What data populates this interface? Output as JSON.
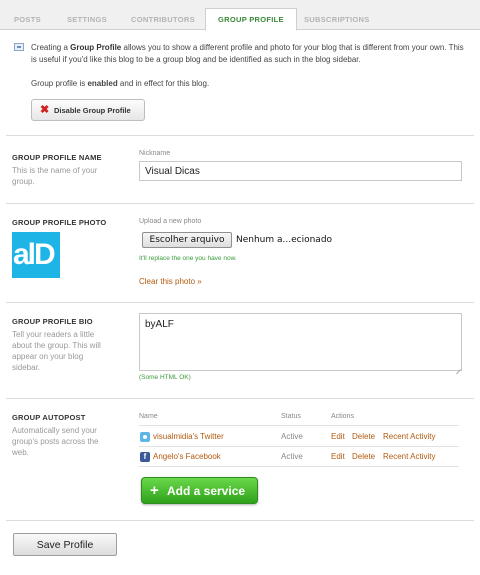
{
  "tabs": [
    {
      "label": "POSTS",
      "active": false
    },
    {
      "label": "SETTINGS",
      "active": false
    },
    {
      "label": "CONTRIBUTORS",
      "active": false
    },
    {
      "label": "GROUP PROFILE",
      "active": true
    },
    {
      "label": "SUBSCRIPTIONS",
      "active": false
    }
  ],
  "intro": {
    "text_before": "Creating a ",
    "text_bold": "Group Profile",
    "text_after": " allows you to show a different profile and photo for your blog that is different from your own. This is useful if you'd like this blog to be a group blog and be identified as such in the blog sidebar.",
    "status_before": "Group profile is ",
    "status_bold": "enabled",
    "status_after": " and in effect for this blog.",
    "disable_label": "Disable Group Profile"
  },
  "name_section": {
    "title": "GROUP PROFILE NAME",
    "desc": "This is the name of your group.",
    "field_label": "Nickname",
    "value": "Visual Dicas"
  },
  "photo_section": {
    "title": "GROUP PROFILE PHOTO",
    "image_text": "alD",
    "upload_label": "Upload a new photo",
    "file_button": "Escolher arquivo",
    "file_name": "Nenhum a...ecionado",
    "replace_hint": "It'll replace the one you have now.",
    "clear_link": "Clear this photo »"
  },
  "bio_section": {
    "title": "GROUP PROFILE BIO",
    "desc": "Tell your readers a little about the group. This will appear on your blog sidebar.",
    "value": "byALF",
    "html_hint": "(Some HTML OK)"
  },
  "autopost_section": {
    "title": "GROUP AUTOPOST",
    "desc": "Automatically send your group's posts across the web.",
    "columns": {
      "name": "Name",
      "status": "Status",
      "actions": "Actions"
    },
    "rows": [
      {
        "icon": "twitter-icon",
        "name": "visualmidia's Twitter",
        "status": "Active",
        "edit": "Edit",
        "delete": "Delete",
        "recent": "Recent Activity"
      },
      {
        "icon": "facebook-icon",
        "icon_letter": "f",
        "name": "Angelo's Facebook",
        "status": "Active",
        "edit": "Edit",
        "delete": "Delete",
        "recent": "Recent Activity"
      }
    ],
    "add_label": "Add a service"
  },
  "save_label": "Save Profile",
  "colors": {
    "active_tab": "#3a8a3a",
    "link": "#b25a10",
    "add_button": "#3aa51e",
    "photo_bg": "#1eb4e6"
  }
}
